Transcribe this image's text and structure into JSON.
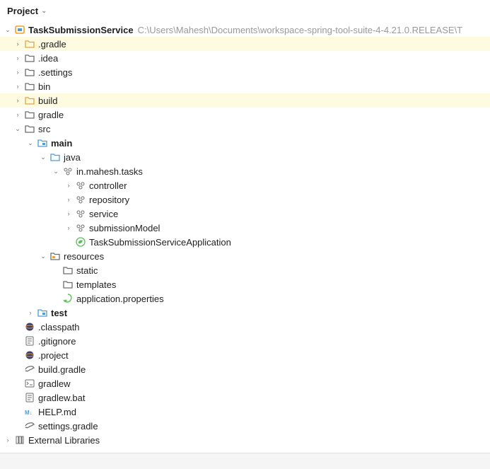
{
  "header": {
    "title": "Project"
  },
  "root": {
    "name": "TaskSubmissionService",
    "path": "C:\\Users\\Mahesh\\Documents\\workspace-spring-tool-suite-4-4.21.0.RELEASE\\T"
  },
  "nodes": {
    "gradle_dir": ".gradle",
    "idea_dir": ".idea",
    "settings_dir": ".settings",
    "bin_dir": "bin",
    "build_dir": "build",
    "gradle_folder": "gradle",
    "src_dir": "src",
    "main_dir": "main",
    "java_dir": "java",
    "pkg": "in.mahesh.tasks",
    "controller_pkg": "controller",
    "repository_pkg": "repository",
    "service_pkg": "service",
    "submissionModel_pkg": "submissionModel",
    "app_class": "TaskSubmissionServiceApplication",
    "resources_dir": "resources",
    "static_dir": "static",
    "templates_dir": "templates",
    "app_properties": "application.properties",
    "test_dir": "test",
    "classpath_file": ".classpath",
    "gitignore_file": ".gitignore",
    "project_file": ".project",
    "build_gradle_file": "build.gradle",
    "gradlew_file": "gradlew",
    "gradlew_bat_file": "gradlew.bat",
    "help_md_file": "HELP.md",
    "settings_gradle_file": "settings.gradle",
    "ext_libraries": "External Libraries"
  }
}
